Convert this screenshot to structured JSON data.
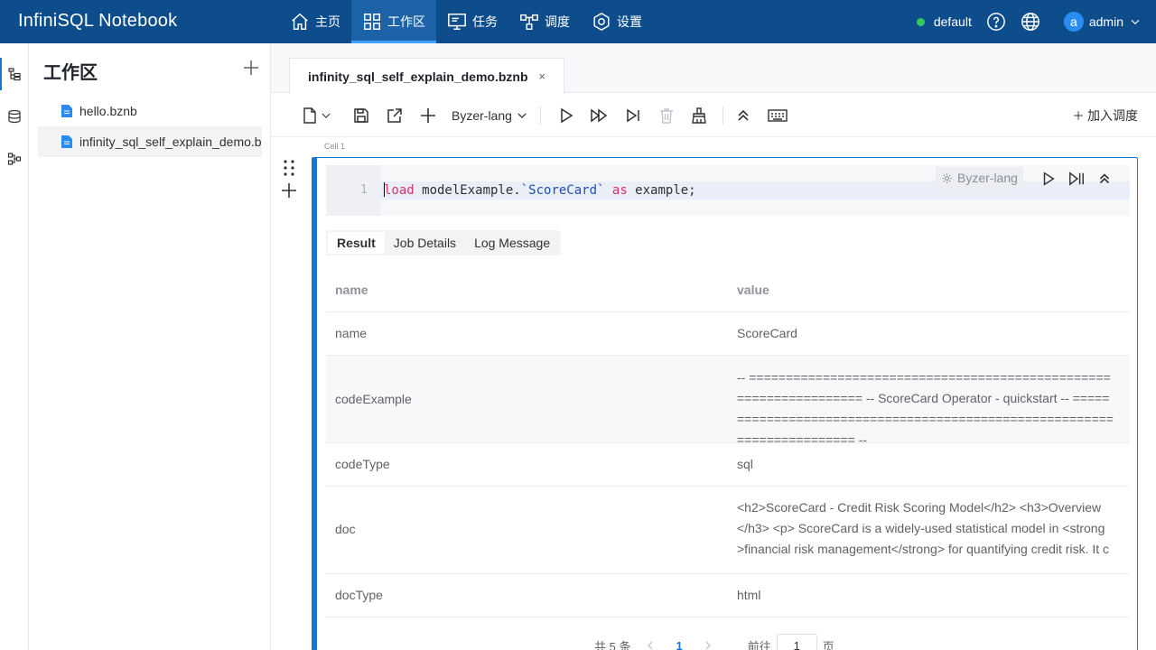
{
  "app": {
    "title": "InfiniSQL Notebook"
  },
  "nav": [
    {
      "label": "主页",
      "icon": "home-icon"
    },
    {
      "label": "工作区",
      "icon": "grid-icon"
    },
    {
      "label": "任务",
      "icon": "monitor-icon"
    },
    {
      "label": "调度",
      "icon": "flow-icon"
    },
    {
      "label": "设置",
      "icon": "settings-icon"
    }
  ],
  "nav_active": "工作区",
  "header": {
    "environment": "default",
    "user_avatar": "a",
    "user_name": "admin"
  },
  "files": {
    "title": "工作区",
    "items": [
      {
        "name": "hello.bznb"
      },
      {
        "name": "infinity_sql_self_explain_demo.bznb"
      }
    ]
  },
  "tabs": [
    {
      "label": "infinity_sql_self_explain_demo.bznb",
      "close": "×"
    }
  ],
  "toolbar": {
    "language": "Byzer-lang",
    "add_schedule": "加入调度"
  },
  "cell": {
    "label": "Cell 1",
    "language": "Byzer-lang",
    "line_number": "1",
    "code": {
      "kw_load": "load",
      "t1": " modelExample.",
      "str": "`ScoreCard`",
      "t2": " ",
      "kw_as": "as",
      "t3": " example;"
    }
  },
  "result_tabs": [
    "Result",
    "Job Details",
    "Log Message"
  ],
  "result_active": "Result",
  "table": {
    "headers": [
      "name",
      "value"
    ],
    "rows": [
      {
        "name": "name",
        "value": "ScoreCard"
      },
      {
        "name": "codeExample",
        "value": "-- ================================================================== -- ScoreCard Operator - quickstart -- ======================================================================== --"
      },
      {
        "name": "codeType",
        "value": "sql"
      },
      {
        "name": "doc",
        "value": "<h2>ScoreCard - Credit Risk Scoring Model</h2> <h3>Overview </h3> <p> ScoreCard is a widely-used statistical model in <strong >financial risk management</strong> for quantifying credit risk. It c"
      },
      {
        "name": "docType",
        "value": "html"
      }
    ]
  },
  "pager": {
    "total": "共 5 条",
    "current": "1",
    "goto": "前往",
    "input_value": "1",
    "page_unit": "页"
  },
  "colors": {
    "header_bg": "#0d4d8c",
    "accent": "#1976d2",
    "status_online": "#34c759"
  }
}
